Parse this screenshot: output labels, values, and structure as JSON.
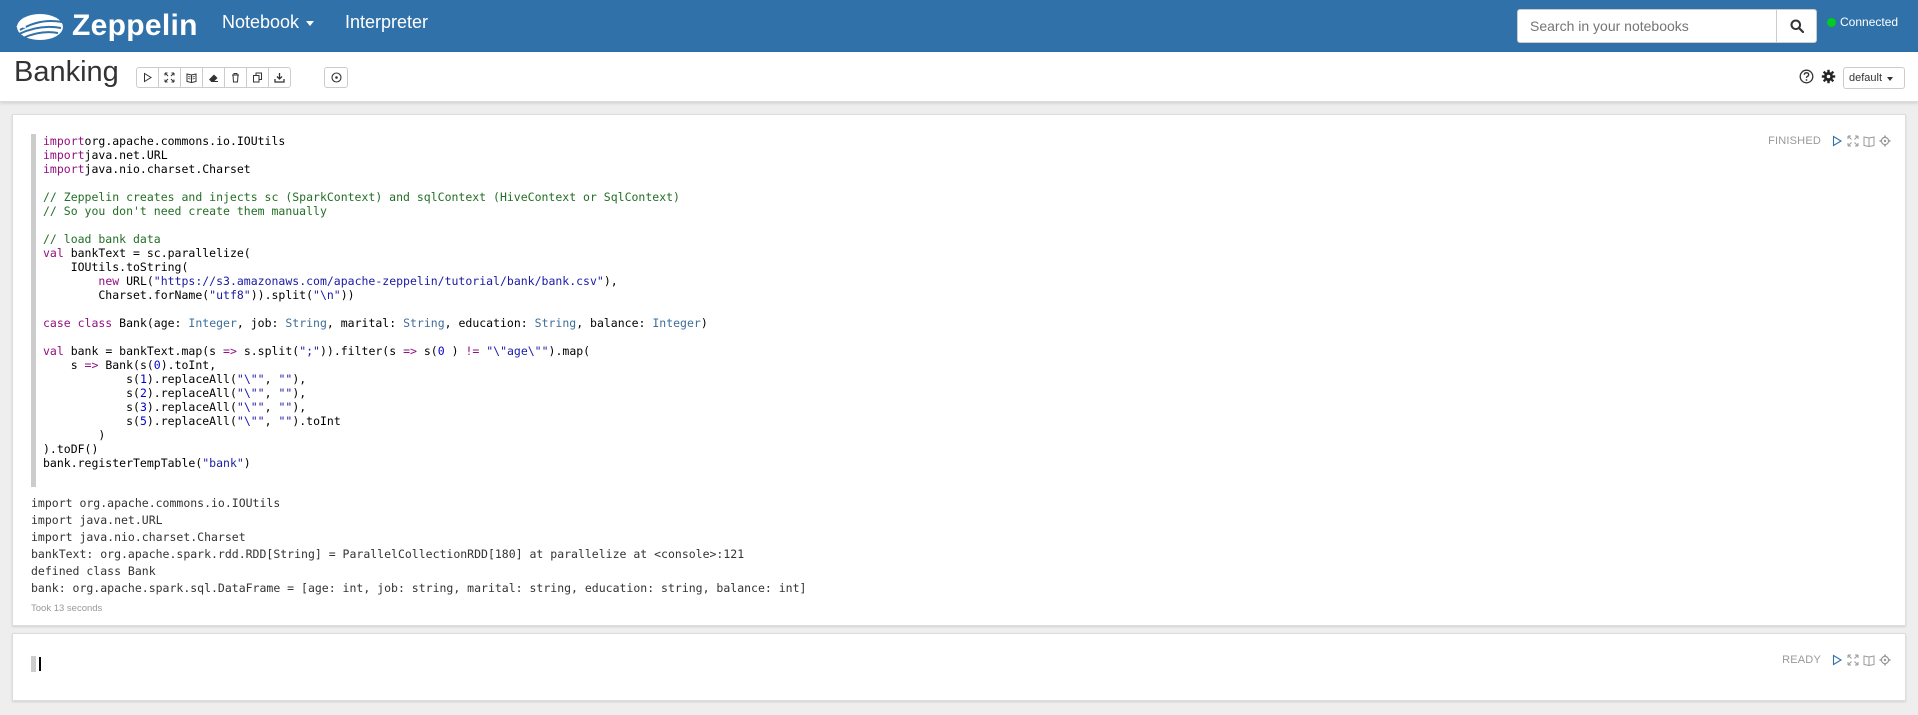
{
  "navbar": {
    "brand": "Zeppelin",
    "notebook_menu": "Notebook",
    "interpreter_link": "Interpreter",
    "search_placeholder": "Search in your notebooks",
    "connection_status": "Connected",
    "connection_color": "#00cc22",
    "bg_color": "#3071a9"
  },
  "header": {
    "title": "Banking",
    "toolbar_icons": [
      "play-icon",
      "expand-icon",
      "book-icon",
      "eraser-icon",
      "trash-icon",
      "copy-icon",
      "download-icon"
    ],
    "schedule_icon": "clock-icon",
    "interpreter_binding": "default"
  },
  "paragraphs": [
    {
      "status": "FINISHED",
      "code_lines": [
        [
          [
            "kw",
            "import"
          ],
          [
            "",
            "org.apache.commons.io.IOUtils"
          ]
        ],
        [
          [
            "kw",
            "import"
          ],
          [
            "",
            "java.net.URL"
          ]
        ],
        [
          [
            "kw",
            "import"
          ],
          [
            "",
            "java.nio.charset.Charset"
          ]
        ],
        [],
        [
          [
            "cm",
            "// Zeppelin creates and injects sc (SparkContext) and sqlContext (HiveContext or SqlContext)"
          ]
        ],
        [
          [
            "cm",
            "// So you don't need create them manually"
          ]
        ],
        [],
        [
          [
            "cm",
            "// load bank data"
          ]
        ],
        [
          [
            "kw",
            "val"
          ],
          [
            "",
            " bankText = sc.parallelize("
          ]
        ],
        [
          [
            "",
            "    IOUtils.toString("
          ]
        ],
        [
          [
            "",
            "        "
          ],
          [
            "kw",
            "new"
          ],
          [
            "",
            " URL("
          ],
          [
            "str",
            "\"https://s3.amazonaws.com/apache-zeppelin/tutorial/bank/bank.csv\""
          ],
          [
            "",
            "),"
          ]
        ],
        [
          [
            "",
            "        Charset.forName("
          ],
          [
            "str",
            "\"utf8\""
          ],
          [
            "",
            ")).split("
          ],
          [
            "str",
            "\"\\n\""
          ],
          [
            "",
            "))"
          ]
        ],
        [],
        [
          [
            "kw",
            "case class"
          ],
          [
            "",
            " Bank(age: "
          ],
          [
            "ty",
            "Integer"
          ],
          [
            "",
            ", job: "
          ],
          [
            "ty",
            "String"
          ],
          [
            "",
            ", marital: "
          ],
          [
            "ty",
            "String"
          ],
          [
            "",
            ", education: "
          ],
          [
            "ty",
            "String"
          ],
          [
            "",
            ", balance: "
          ],
          [
            "ty",
            "Integer"
          ],
          [
            "",
            ")"
          ]
        ],
        [],
        [
          [
            "kw",
            "val"
          ],
          [
            "",
            " bank = bankText.map(s "
          ],
          [
            "kw",
            "=>"
          ],
          [
            "",
            " s.split("
          ],
          [
            "str",
            "\";\""
          ],
          [
            "",
            ")).filter(s "
          ],
          [
            "kw",
            "=>"
          ],
          [
            "",
            " s("
          ],
          [
            "num",
            "0"
          ],
          [
            "",
            " ) "
          ],
          [
            "kw",
            "!="
          ],
          [
            "",
            ""
          ],
          [
            "str",
            " \"\\\"age\\\"\""
          ],
          [
            "",
            ").map("
          ]
        ],
        [
          [
            "",
            "    s "
          ],
          [
            "kw",
            "=>"
          ],
          [
            "",
            " Bank(s("
          ],
          [
            "num",
            "0"
          ],
          [
            "",
            ").toInt,"
          ]
        ],
        [
          [
            "",
            "            s("
          ],
          [
            "num",
            "1"
          ],
          [
            "",
            ").replaceAll("
          ],
          [
            "str",
            "\"\\\"\""
          ],
          [
            "",
            ", "
          ],
          [
            "str",
            "\"\""
          ],
          [
            "",
            "),"
          ]
        ],
        [
          [
            "",
            "            s("
          ],
          [
            "num",
            "2"
          ],
          [
            "",
            ").replaceAll("
          ],
          [
            "str",
            "\"\\\"\""
          ],
          [
            "",
            ", "
          ],
          [
            "str",
            "\"\""
          ],
          [
            "",
            "),"
          ]
        ],
        [
          [
            "",
            "            s("
          ],
          [
            "num",
            "3"
          ],
          [
            "",
            ").replaceAll("
          ],
          [
            "str",
            "\"\\\"\""
          ],
          [
            "",
            ", "
          ],
          [
            "str",
            "\"\""
          ],
          [
            "",
            "),"
          ]
        ],
        [
          [
            "",
            "            s("
          ],
          [
            "num",
            "5"
          ],
          [
            "",
            ").replaceAll("
          ],
          [
            "str",
            "\"\\\"\""
          ],
          [
            "",
            ", "
          ],
          [
            "str",
            "\"\""
          ],
          [
            "",
            ").toInt"
          ]
        ],
        [
          [
            "",
            "        )"
          ]
        ],
        [
          [
            "",
            ").toDF()"
          ]
        ],
        [
          [
            "",
            "bank.registerTempTable("
          ],
          [
            "str",
            "\"bank\""
          ],
          [
            "",
            ")"
          ]
        ]
      ],
      "output_lines": [
        "import org.apache.commons.io.IOUtils",
        "import java.net.URL",
        "import java.nio.charset.Charset",
        "bankText: org.apache.spark.rdd.RDD[String] = ParallelCollectionRDD[180] at parallelize at <console>:121",
        "defined class Bank",
        "bank: org.apache.spark.sql.DataFrame = [age: int, job: string, marital: string, education: string, balance: int]"
      ],
      "elapsed": "Took 13 seconds"
    },
    {
      "status": "READY"
    }
  ]
}
